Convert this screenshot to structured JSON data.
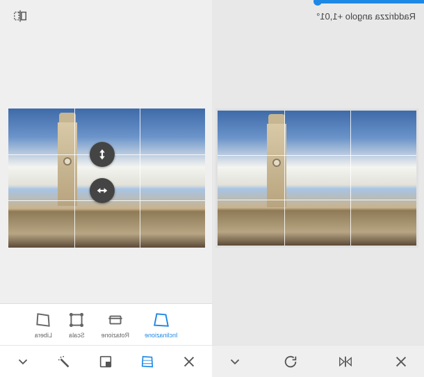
{
  "status": {
    "straighten_label": "Raddrizza angolo +1,01°"
  },
  "tabs": {
    "tilt": {
      "label": "Inclinazione"
    },
    "rotate": {
      "label": "Rotazione"
    },
    "scale": {
      "label": "Scala"
    },
    "free": {
      "label": "Libera"
    }
  },
  "icons": {
    "flip": "flip-horizontal-icon",
    "confirm": "chevron-down-icon",
    "close": "close-icon",
    "perspective": "perspective-icon",
    "aspect": "aspect-icon",
    "magic": "magic-wand-icon",
    "rotate90": "rotate-left-icon",
    "mirror": "mirror-icon"
  },
  "handles": {
    "vertical": "vertical-drag-handle",
    "horizontal": "horizontal-drag-handle"
  },
  "colors": {
    "accent": "#1e88e5",
    "icon": "#555555"
  }
}
